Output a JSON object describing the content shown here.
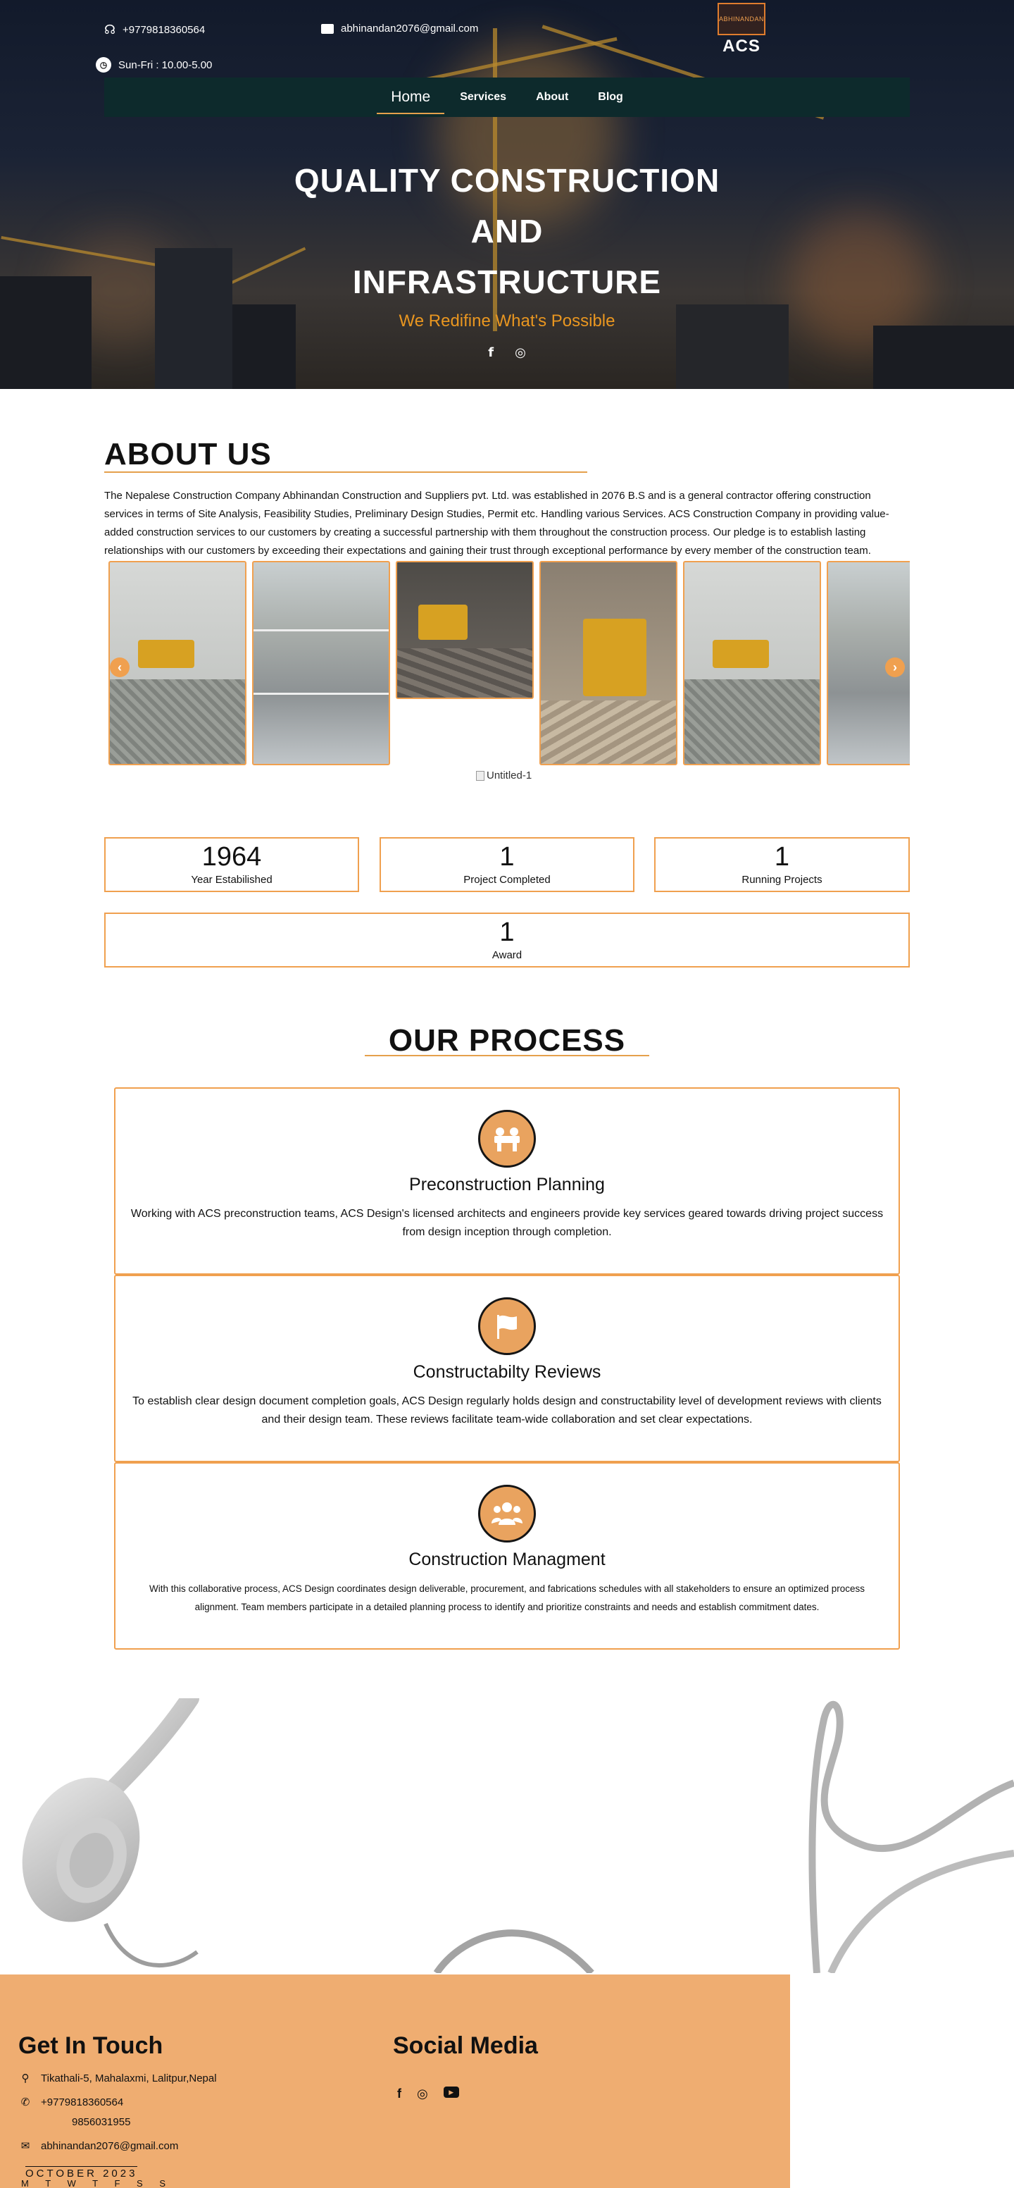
{
  "topbar": {
    "phone": "+9779818360564",
    "email": "abhinandan2076@gmail.com",
    "hours": "Sun-Fri : 10.00-5.00"
  },
  "logo": {
    "emblem_text": "ABHINANDAN",
    "text": "ACS"
  },
  "nav": [
    {
      "label": "Home",
      "active": true
    },
    {
      "label": "Services"
    },
    {
      "label": "About"
    },
    {
      "label": "Blog"
    }
  ],
  "hero": {
    "title_line1": "QUALITY CONSTRUCTION",
    "title_line2": "AND",
    "title_line3": "INFRASTRUCTURE",
    "subtitle": "We Redifine What's Possible",
    "social_icons": [
      "facebook-icon",
      "instagram-icon"
    ],
    "accent_color": "#e99620"
  },
  "about": {
    "title": "ABOUT US",
    "text": "The Nepalese Construction Company Abhinandan Construction and Suppliers  pvt. Ltd. was established in 2076 B.S and is a general contractor offering construction services in terms of Site Analysis, Feasibility Studies, Preliminary Design Studies, Permit etc. Handling various Services. ACS  Construction Company in providing value-added construction services to our customers by creating a successful partnership with them throughout the construction process. Our pledge is to establish lasting relationships with our customers by exceeding their expectations and gaining their trust through exceptional performance by every member of the construction team.",
    "broken_image_alt": "Untitled-1"
  },
  "stats": [
    {
      "number": "1964",
      "label": "Year Estabilished"
    },
    {
      "number": "1",
      "label": "Project Completed"
    },
    {
      "number": "1",
      "label": "Running Projects"
    },
    {
      "number": "1",
      "label": "Award"
    }
  ],
  "process": {
    "title": "OUR PROCESS",
    "steps": [
      {
        "icon": "team-icon",
        "name": "Preconstruction Planning",
        "desc": "Working with ACS preconstruction teams, ACS Design's licensed architects and engineers provide key services geared towards driving project success from design inception through completion."
      },
      {
        "icon": "flag-icon",
        "name": "Constructabilty Reviews",
        "desc": "To establish clear design document completion goals, ACS Design regularly holds design and constructability level of development reviews with clients and their design team. These reviews facilitate team-wide collaboration and set clear expectations."
      },
      {
        "icon": "group-icon",
        "name": "Construction Managment",
        "desc": "With this collaborative process, ACS Design coordinates design deliverable, procurement, and fabrications schedules with all stakeholders to ensure an optimized process alignment. Team members participate in a detailed planning process to identify and prioritize constraints and needs and establish commitment dates."
      }
    ]
  },
  "footer": {
    "contact_title": "Get In Touch",
    "address": "Tikathali-5, Mahalaxmi, Lalitpur,Nepal",
    "phone1": "+9779818360564",
    "phone2": "9856031955",
    "email": "abhinandan2076@gmail.com",
    "social_title": "Social Media",
    "social_icons": [
      "facebook-icon",
      "instagram-icon",
      "youtube-icon"
    ],
    "calendar_month": "OCTOBER 2023",
    "calendar_days": "M T W T F S S",
    "background_color": "#efad71"
  }
}
